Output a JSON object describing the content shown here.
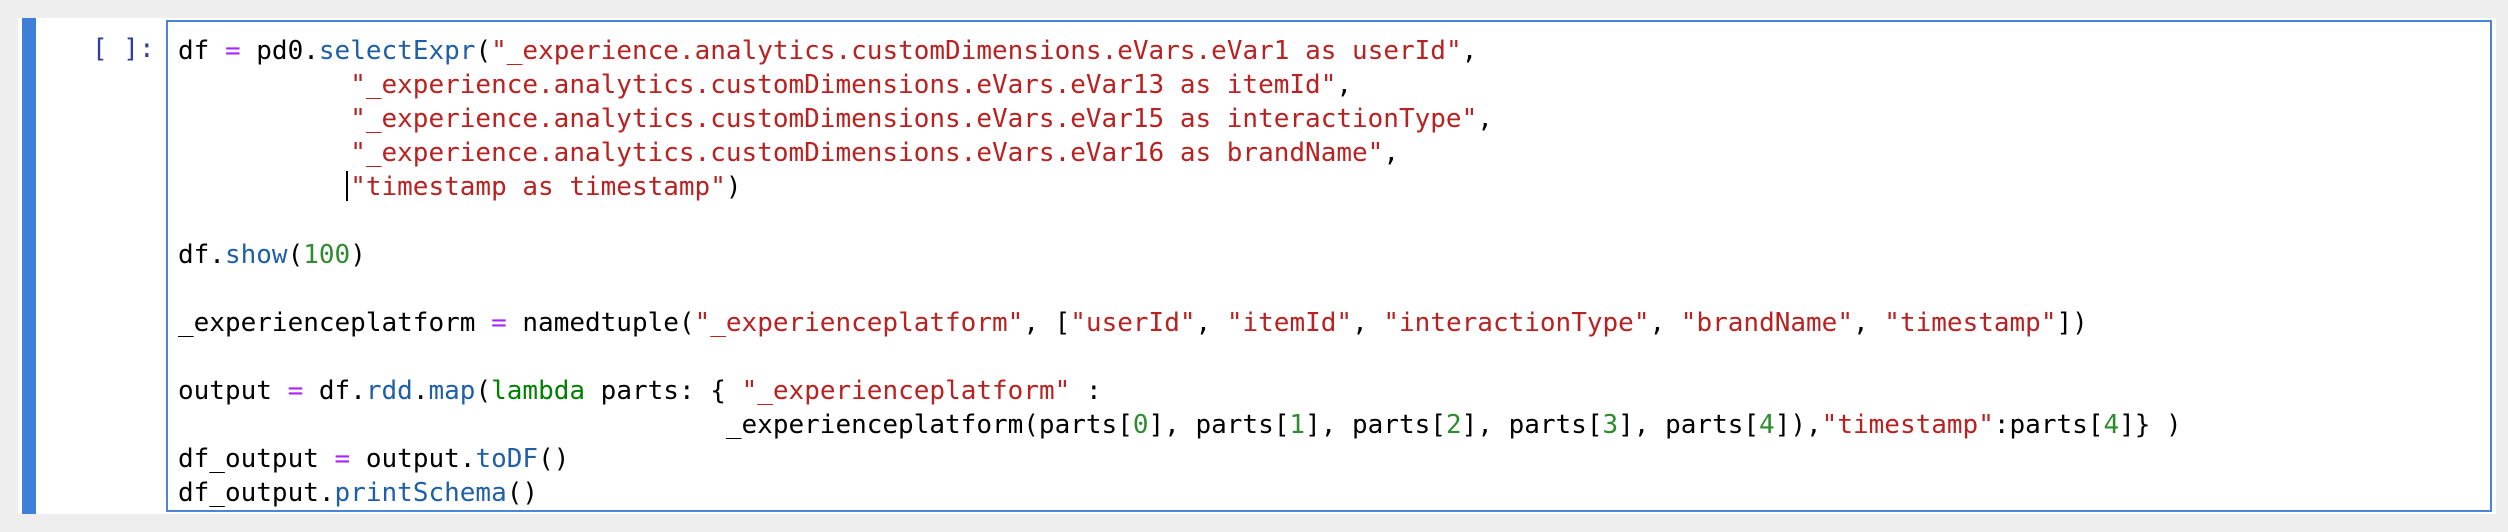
{
  "cell": {
    "prompt": "[ ]:",
    "accent_color": "#3f7fd8",
    "lines": [
      [
        "df",
        " ",
        "=",
        " pd0.",
        "selectExpr",
        "(",
        "\"_experience.analytics.customDimensions.eVars.eVar1 as userId\"",
        ","
      ],
      [
        "           ",
        "\"_experience.analytics.customDimensions.eVars.eVar13 as itemId\"",
        ","
      ],
      [
        "           ",
        "\"_experience.analytics.customDimensions.eVars.eVar15 as interactionType\"",
        ","
      ],
      [
        "           ",
        "\"_experience.analytics.customDimensions.eVars.eVar16 as brandName\"",
        ","
      ],
      [
        "           ",
        "\"timestamp as timestamp\"",
        ")"
      ],
      [
        ""
      ],
      [
        "df.",
        "show",
        "(",
        "100",
        ")"
      ],
      [
        ""
      ],
      [
        "_experienceplatform",
        " ",
        "=",
        " namedtuple(",
        "\"_experienceplatform\"",
        ", [",
        "\"userId\"",
        ", ",
        "\"itemId\"",
        ", ",
        "\"interactionType\"",
        ", ",
        "\"brandName\"",
        ", ",
        "\"timestamp\"",
        "])"
      ],
      [
        ""
      ],
      [
        "output",
        " ",
        "=",
        " df.",
        "rdd",
        ".",
        "map",
        "(",
        "lambda",
        " parts: { ",
        "\"_experienceplatform\"",
        " :"
      ],
      [
        "                                   _experienceplatform(parts[",
        "0",
        "], parts[",
        "1",
        "], parts[",
        "2",
        "], parts[",
        "3",
        "], parts[",
        "4",
        "]),",
        "\"timestamp\"",
        ":parts[",
        "4",
        "]} )"
      ],
      [
        "df_output",
        " ",
        "=",
        " output.",
        "toDF",
        "()"
      ],
      [
        "df_output.",
        "printSchema",
        "()"
      ]
    ]
  }
}
